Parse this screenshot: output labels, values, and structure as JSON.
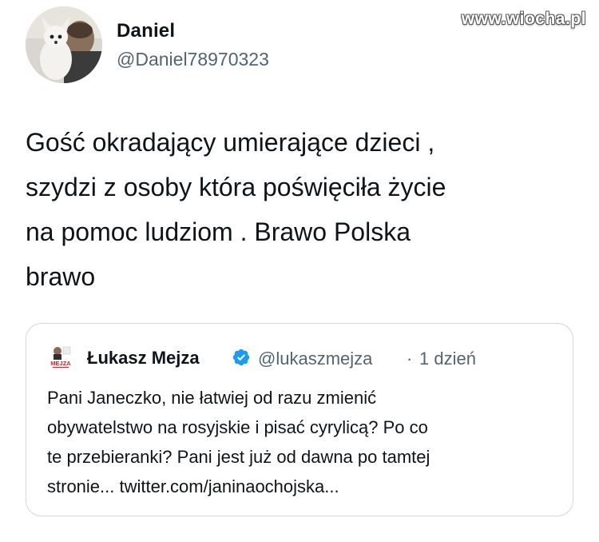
{
  "watermark": "www.wiocha.pl",
  "author": {
    "display_name": "Daniel",
    "handle": "@Daniel78970323",
    "avatar_icon": "profile-photo-with-dog"
  },
  "tweet": {
    "text": "Gość okradający umierające dzieci ,\nszydzi z osoby która poświęciła życie\nna pomoc ludziom . Brawo Polska\nbrawo"
  },
  "quoted": {
    "display_name": "Łukasz Mejza",
    "verified_icon": "verified-badge-icon",
    "handle": "@lukaszmejza",
    "separator": "·",
    "time": "1 dzień",
    "avatar_label": "MEJZA",
    "text": "Pani Janeczko, nie łatwiej od razu zmienić\nobywatelstwo na rosyjskie i pisać cyrylicą? Po co\nte przebieranki? Pani jest już od dawna po tamtej\nstronie... twitter.com/janinaochojska...",
    "verified_color": "#1d9bf0",
    "avatar_accent": "#e0202a"
  }
}
